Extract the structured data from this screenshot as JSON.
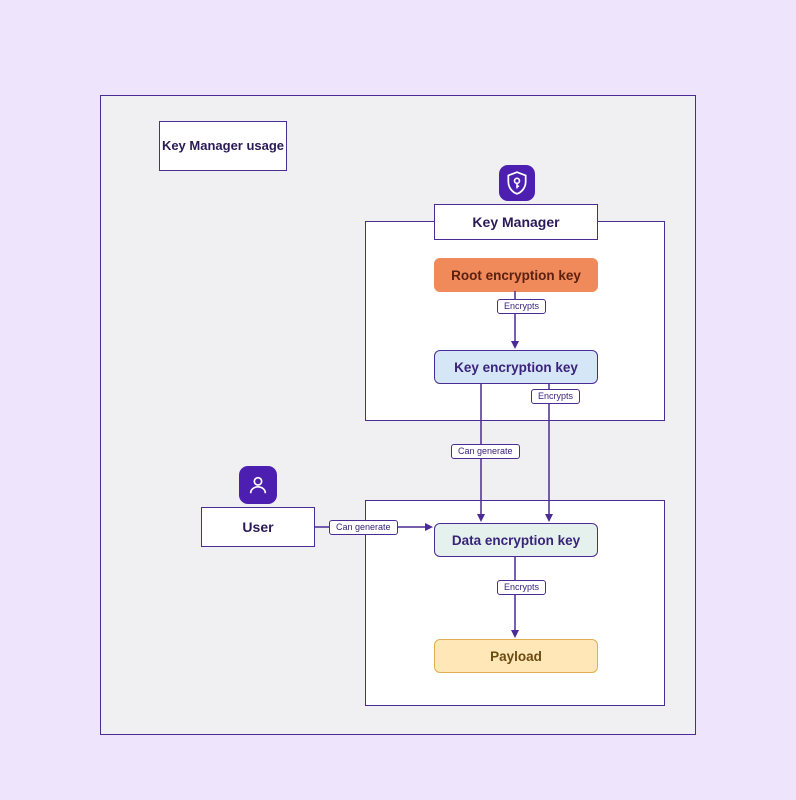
{
  "title": "Key Manager usage",
  "groups": {
    "key_manager": "Key Manager",
    "user": "User"
  },
  "nodes": {
    "root": "Root encryption key",
    "kek": "Key encryption key",
    "dek": "Data encryption key",
    "payload": "Payload"
  },
  "edges": {
    "encrypts": "Encrypts",
    "can_generate": "Can generate"
  }
}
